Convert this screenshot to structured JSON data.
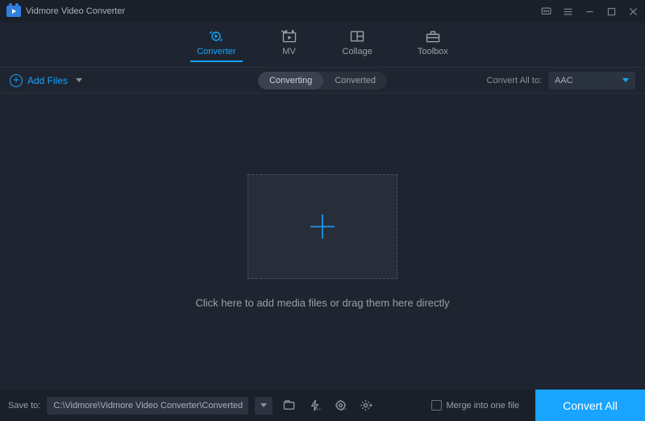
{
  "app_title": "Vidmore Video Converter",
  "tabs": [
    {
      "id": "converter",
      "label": "Converter",
      "active": true
    },
    {
      "id": "mv",
      "label": "MV",
      "active": false
    },
    {
      "id": "collage",
      "label": "Collage",
      "active": false
    },
    {
      "id": "toolbox",
      "label": "Toolbox",
      "active": false
    }
  ],
  "add_files_label": "Add Files",
  "subtabs": {
    "converting": "Converting",
    "converted": "Converted"
  },
  "convert_all_to_label": "Convert All to:",
  "format_selected": "AAC",
  "drop_hint": "Click here to add media files or drag them here directly",
  "save_to_label": "Save to:",
  "save_path": "C:\\Vidmore\\Vidmore Video Converter\\Converted",
  "merge_label": "Merge into one file",
  "convert_button": "Convert All"
}
